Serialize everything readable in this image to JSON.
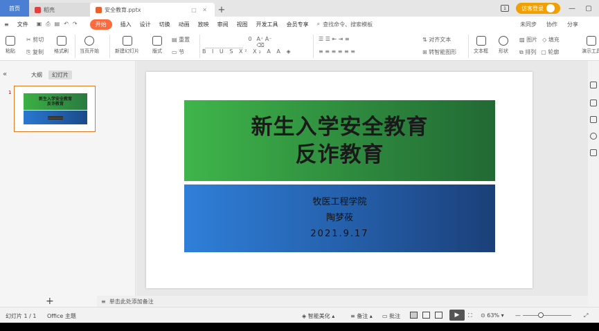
{
  "titlebar": {
    "tabs": [
      {
        "label": "首页"
      },
      {
        "label": "稻壳"
      },
      {
        "label": "安全教育.pptx"
      }
    ],
    "login_label": "访客登录"
  },
  "menubar": {
    "file_label": "文件",
    "items": [
      "开始",
      "插入",
      "设计",
      "切换",
      "动画",
      "放映",
      "审阅",
      "视图",
      "开发工具",
      "会员专享"
    ],
    "search_label": "查找命令、搜索模板",
    "right_items": [
      "未同步",
      "协作",
      "分享"
    ]
  },
  "ribbon": {
    "paste": "粘贴",
    "cut": "剪切",
    "copy": "复制",
    "format_painter": "格式刷",
    "play_from_current": "当页开始",
    "new_slide": "新建幻灯片",
    "layout": "版式",
    "section": "节",
    "reset": "重置",
    "font_size": "0",
    "align_text": "对齐文本",
    "convert_smartart": "转智能图形",
    "textbox": "文本框",
    "shape": "形状",
    "picture": "图片",
    "fill": "填充",
    "arrange": "排列",
    "outline": "轮廓",
    "theme_label": "演示工具"
  },
  "leftpanel": {
    "tab_outline": "大纲",
    "tab_slides": "幻灯片",
    "slide_number": "1"
  },
  "slide": {
    "title_line1": "新生入学安全教育",
    "title_line2": "反诈教育",
    "college": "牧医工程学院",
    "presenter": "陶梦莜",
    "date": "2021.9.17"
  },
  "notes_placeholder": "单击此处添加备注",
  "status": {
    "slide_counter": "幻灯片 1 / 1",
    "theme": "Office 主题",
    "beautify": "智能美化",
    "notes": "备注",
    "comments": "批注",
    "zoom": "63%"
  }
}
